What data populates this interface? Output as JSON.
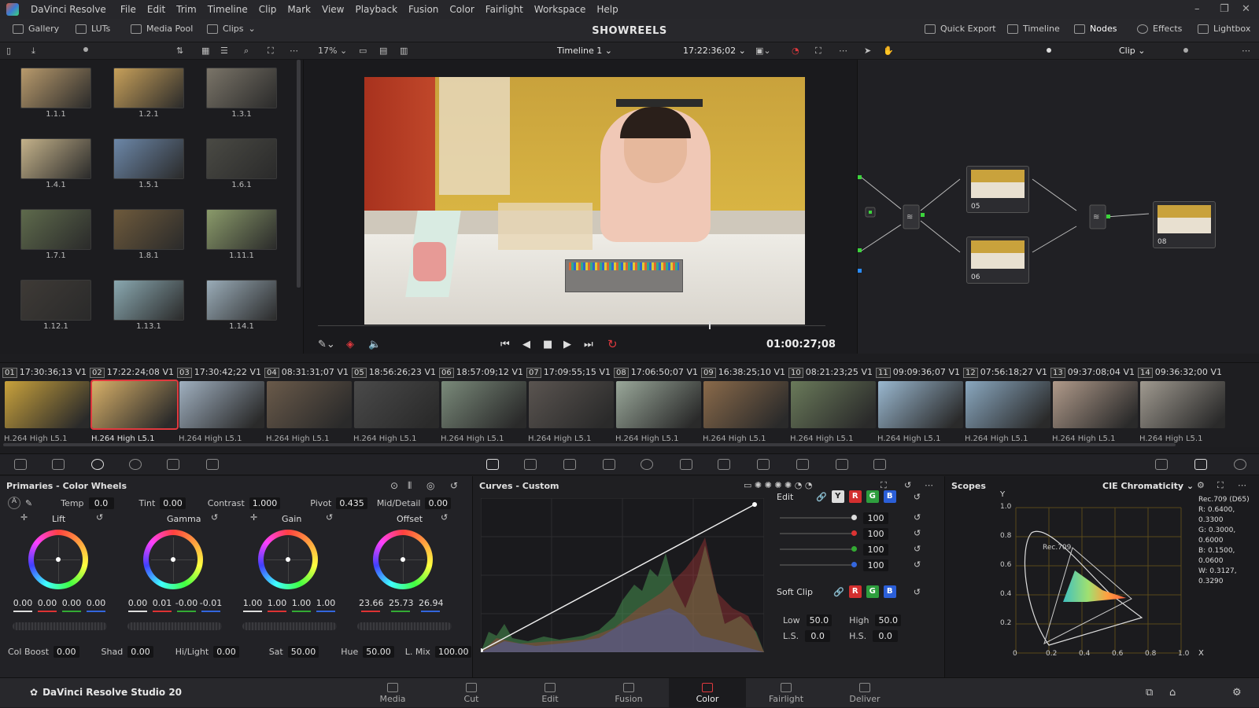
{
  "app": {
    "name": "DaVinci Resolve",
    "studio": "DaVinci Resolve Studio 20"
  },
  "menu": [
    "File",
    "Edit",
    "Trim",
    "Timeline",
    "Clip",
    "Mark",
    "View",
    "Playback",
    "Fusion",
    "Color",
    "Fairlight",
    "Workspace",
    "Help"
  ],
  "window_controls": {
    "minimize": "–",
    "maximize": "❐",
    "close": "✕"
  },
  "topbar": {
    "gallery": "Gallery",
    "luts": "LUTs",
    "media_pool": "Media Pool",
    "clips": "Clips",
    "project_title": "SHOWREELS",
    "quick_export": "Quick Export",
    "timeline": "Timeline",
    "nodes": "Nodes",
    "effects": "Effects",
    "lightbox": "Lightbox"
  },
  "viewer_toolbar": {
    "zoom": "17%",
    "timeline_name": "Timeline 1",
    "timecode_in": "17:22:36;02",
    "mode": "Clip"
  },
  "gallery": {
    "stills": [
      "1.1.1",
      "1.2.1",
      "1.3.1",
      "1.4.1",
      "1.5.1",
      "1.6.1",
      "1.7.1",
      "1.8.1",
      "1.11.1",
      "1.12.1",
      "1.13.1",
      "1.14.1"
    ]
  },
  "viewer": {
    "timecode": "01:00:27;08",
    "playhead_fraction": 0.77
  },
  "node_graph": {
    "nodes": [
      {
        "label": "05"
      },
      {
        "label": "06"
      },
      {
        "label": "08"
      }
    ]
  },
  "clips": [
    {
      "num": "01",
      "tc": "17:30:36;13",
      "track": "V1",
      "codec": "H.264 High L5.1"
    },
    {
      "num": "02",
      "tc": "17:22:24;08",
      "track": "V1",
      "codec": "H.264 High L5.1",
      "selected": true
    },
    {
      "num": "03",
      "tc": "17:30:42;22",
      "track": "V1",
      "codec": "H.264 High L5.1"
    },
    {
      "num": "04",
      "tc": "08:31:31;07",
      "track": "V1",
      "codec": "H.264 High L5.1"
    },
    {
      "num": "05",
      "tc": "18:56:26;23",
      "track": "V1",
      "codec": "H.264 High L5.1"
    },
    {
      "num": "06",
      "tc": "18:57:09;12",
      "track": "V1",
      "codec": "H.264 High L5.1"
    },
    {
      "num": "07",
      "tc": "17:09:55;15",
      "track": "V1",
      "codec": "H.264 High L5.1"
    },
    {
      "num": "08",
      "tc": "17:06:50;07",
      "track": "V1",
      "codec": "H.264 High L5.1"
    },
    {
      "num": "09",
      "tc": "16:38:25;10",
      "track": "V1",
      "codec": "H.264 High L5.1"
    },
    {
      "num": "10",
      "tc": "08:21:23;25",
      "track": "V1",
      "codec": "H.264 High L5.1"
    },
    {
      "num": "11",
      "tc": "09:09:36;07",
      "track": "V1",
      "codec": "H.264 High L5.1"
    },
    {
      "num": "12",
      "tc": "07:56:18;27",
      "track": "V1",
      "codec": "H.264 High L5.1"
    },
    {
      "num": "13",
      "tc": "09:37:08;04",
      "track": "V1",
      "codec": "H.264 High L5.1"
    },
    {
      "num": "14",
      "tc": "09:36:32;00",
      "track": "V1",
      "codec": "H.264 High L5.1"
    }
  ],
  "primaries": {
    "title": "Primaries - Color Wheels",
    "temp_label": "Temp",
    "temp": "0.0",
    "tint_label": "Tint",
    "tint": "0.00",
    "contrast_label": "Contrast",
    "contrast": "1.000",
    "pivot_label": "Pivot",
    "pivot": "0.435",
    "middetail_label": "Mid/Detail",
    "middetail": "0.00",
    "wheels": [
      {
        "name": "Lift",
        "values": [
          "0.00",
          "0.00",
          "0.00",
          "0.00"
        ]
      },
      {
        "name": "Gamma",
        "values": [
          "0.00",
          "0.01",
          "-0.00",
          "-0.01"
        ]
      },
      {
        "name": "Gain",
        "values": [
          "1.00",
          "1.00",
          "1.00",
          "1.00"
        ]
      },
      {
        "name": "Offset",
        "values": [
          "23.66",
          "25.73",
          "26.94"
        ]
      }
    ],
    "colboost_label": "Col Boost",
    "colboost": "0.00",
    "shad_label": "Shad",
    "shad": "0.00",
    "hilight_label": "Hi/Light",
    "hilight": "0.00",
    "sat_label": "Sat",
    "sat": "50.00",
    "hue_label": "Hue",
    "hue": "50.00",
    "lmix_label": "L. Mix",
    "lmix": "100.00"
  },
  "curves": {
    "title": "Curves - Custom",
    "edit_label": "Edit",
    "channels": [
      "Y",
      "R",
      "G",
      "B"
    ],
    "intensities": [
      "100",
      "100",
      "100",
      "100"
    ],
    "softclip_label": "Soft Clip",
    "low_label": "Low",
    "low": "50.0",
    "high_label": "High",
    "high": "50.0",
    "ls_label": "L.S.",
    "ls": "0.0",
    "hs_label": "H.S.",
    "hs": "0.0"
  },
  "scopes": {
    "title": "Scopes",
    "mode": "CIE Chromaticity",
    "y_label": "Y",
    "x_label": "X",
    "gamut_label": "Rec.709",
    "info": [
      "Rec.709 (D65)",
      "R: 0.6400, 0.3300",
      "G: 0.3000, 0.6000",
      "B: 0.1500, 0.0600",
      "W: 0.3127, 0.3290"
    ],
    "y_ticks": [
      "1.0",
      "0.8",
      "0.6",
      "0.4",
      "0.2"
    ],
    "x_ticks": [
      "0",
      "0.2",
      "0.4",
      "0.6",
      "0.8",
      "1.0"
    ]
  },
  "pages": [
    {
      "name": "Media"
    },
    {
      "name": "Cut"
    },
    {
      "name": "Edit"
    },
    {
      "name": "Fusion"
    },
    {
      "name": "Color",
      "active": true
    },
    {
      "name": "Fairlight"
    },
    {
      "name": "Deliver"
    }
  ],
  "colors": {
    "accent_red": "#e0393e",
    "bg": "#1d1d20",
    "panel": "#28282c"
  }
}
